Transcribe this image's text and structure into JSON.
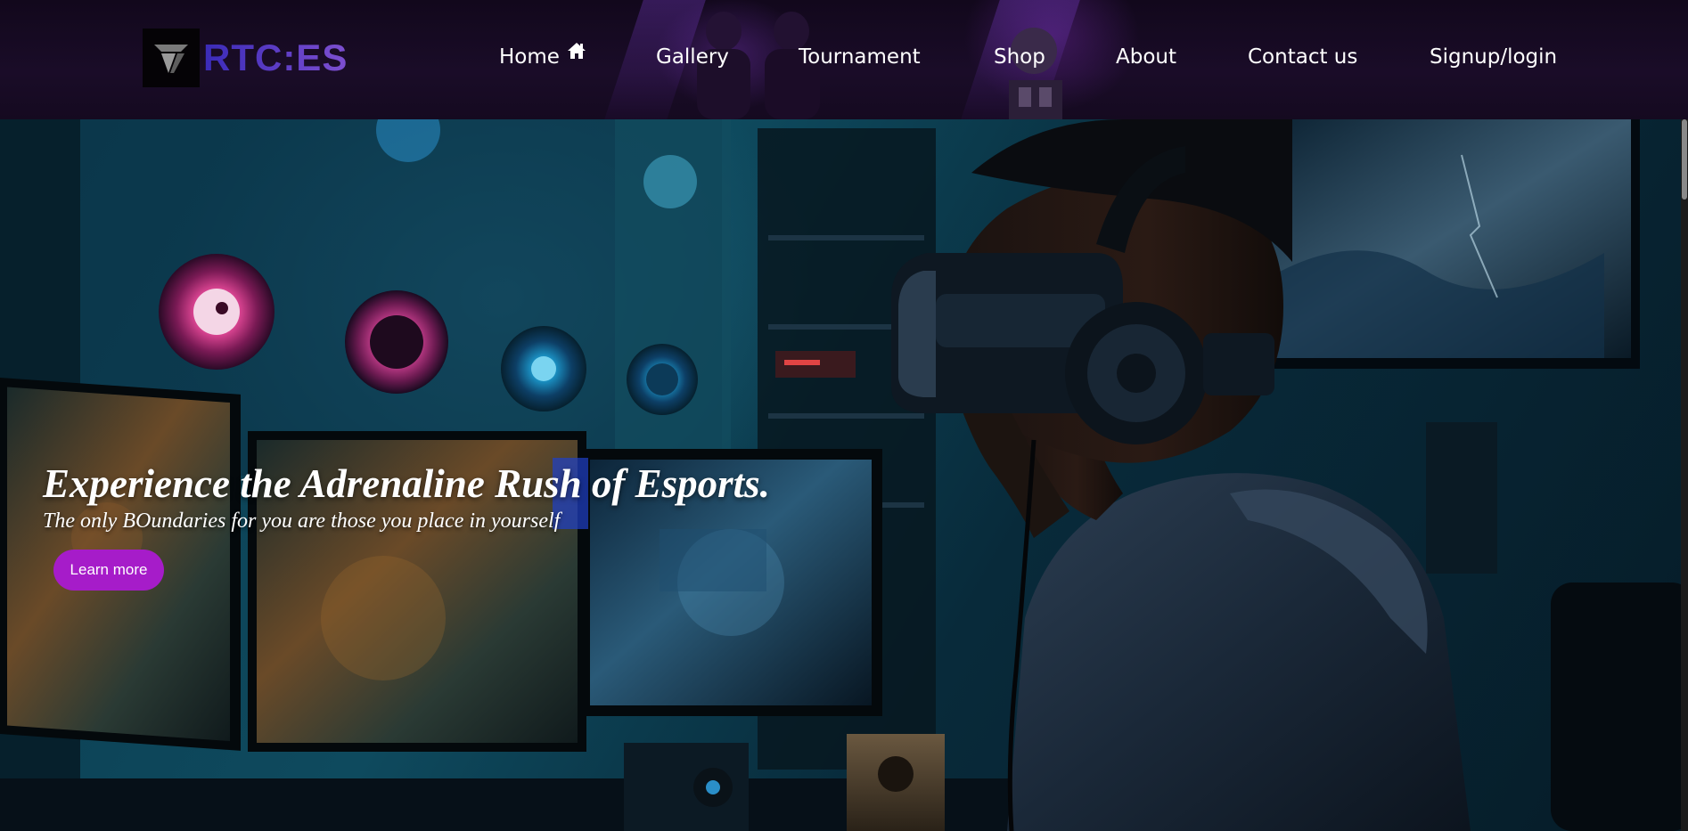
{
  "brand": {
    "name": "RTC:ES",
    "logo_icon": "rtces-logo-icon",
    "gradient_start": "#3a2bb8",
    "gradient_end": "#7d4fd0"
  },
  "nav": {
    "items": [
      {
        "label": "Home",
        "icon": "home-icon"
      },
      {
        "label": "Gallery"
      },
      {
        "label": "Tournament"
      },
      {
        "label": "Shop"
      },
      {
        "label": "About"
      },
      {
        "label": "Contact us"
      },
      {
        "label": "Signup/login"
      }
    ]
  },
  "hero": {
    "title": "Experience the Adrenaline Rush of Esports.",
    "subtitle": "The only BOundaries for you are those you place in yourself",
    "cta_label": "Learn more",
    "cta_color": "#a61cc9",
    "image_subject": "gamer-with-vr-headset-photo"
  }
}
